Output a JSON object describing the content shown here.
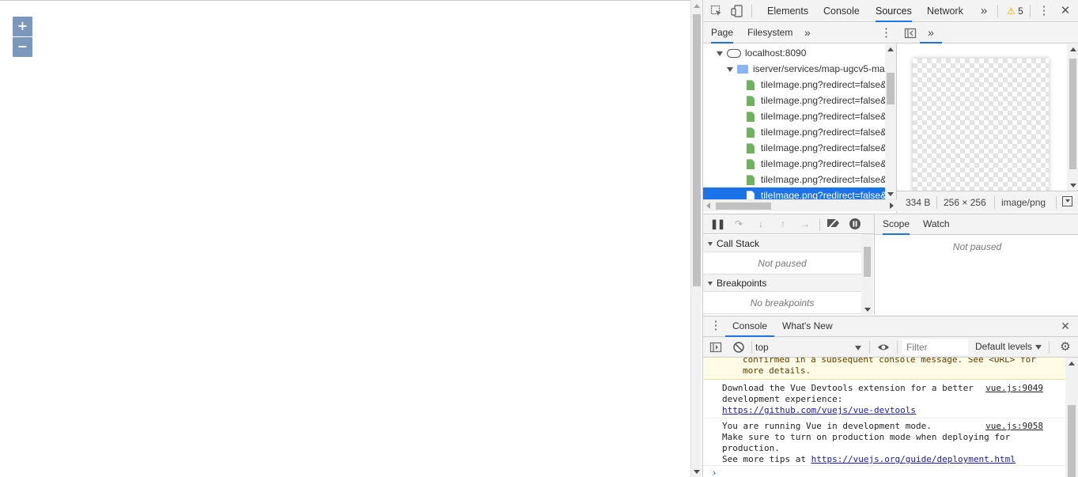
{
  "map": {
    "zoom_in": "+",
    "zoom_out": "−"
  },
  "devtools": {
    "main_tabs": [
      "Elements",
      "Console",
      "Sources",
      "Network"
    ],
    "active_tab": "Sources",
    "more_tabs": "»",
    "warning_count": "5",
    "navigator": {
      "tabs": [
        "Page",
        "Filesystem"
      ],
      "more": "»",
      "host": "localhost:8090",
      "folder": "iserver/services/map-ugcv5-ma",
      "files": [
        "tileImage.png?redirect=false&",
        "tileImage.png?redirect=false&",
        "tileImage.png?redirect=false&",
        "tileImage.png?redirect=false&",
        "tileImage.png?redirect=false&",
        "tileImage.png?redirect=false&",
        "tileImage.png?redirect=false&",
        "tileImage.png?redirect=false&"
      ]
    },
    "preview": {
      "more": "»",
      "size": "334 B",
      "dimensions": "256 × 256",
      "mime": "image/png"
    },
    "debugger": {
      "call_stack": "Call Stack",
      "call_stack_empty": "Not paused",
      "breakpoints": "Breakpoints",
      "breakpoints_empty": "No breakpoints",
      "tabs": [
        "Scope",
        "Watch"
      ],
      "scope_empty": "Not paused"
    },
    "drawer": {
      "tabs": [
        "Console",
        "What's New"
      ],
      "context": "top",
      "filter_placeholder": "Filter",
      "levels": "Default levels"
    },
    "console": {
      "warning_lines": [
        "confirmed in a subsequent console message. See <URL> for",
        "more details."
      ],
      "messages": [
        {
          "lines": [
            "Download the Vue Devtools extension for a better",
            "development experience:"
          ],
          "link": "https://github.com/vuejs/vue-devtools",
          "source": "vue.js:9049"
        },
        {
          "lines": [
            "You are running Vue in development mode.",
            "Make sure to turn on production mode when deploying for",
            "production.",
            "See more tips at "
          ],
          "link": "https://vuejs.org/guide/deployment.html",
          "source": "vue.js:9058"
        }
      ],
      "prompt": "›"
    }
  }
}
